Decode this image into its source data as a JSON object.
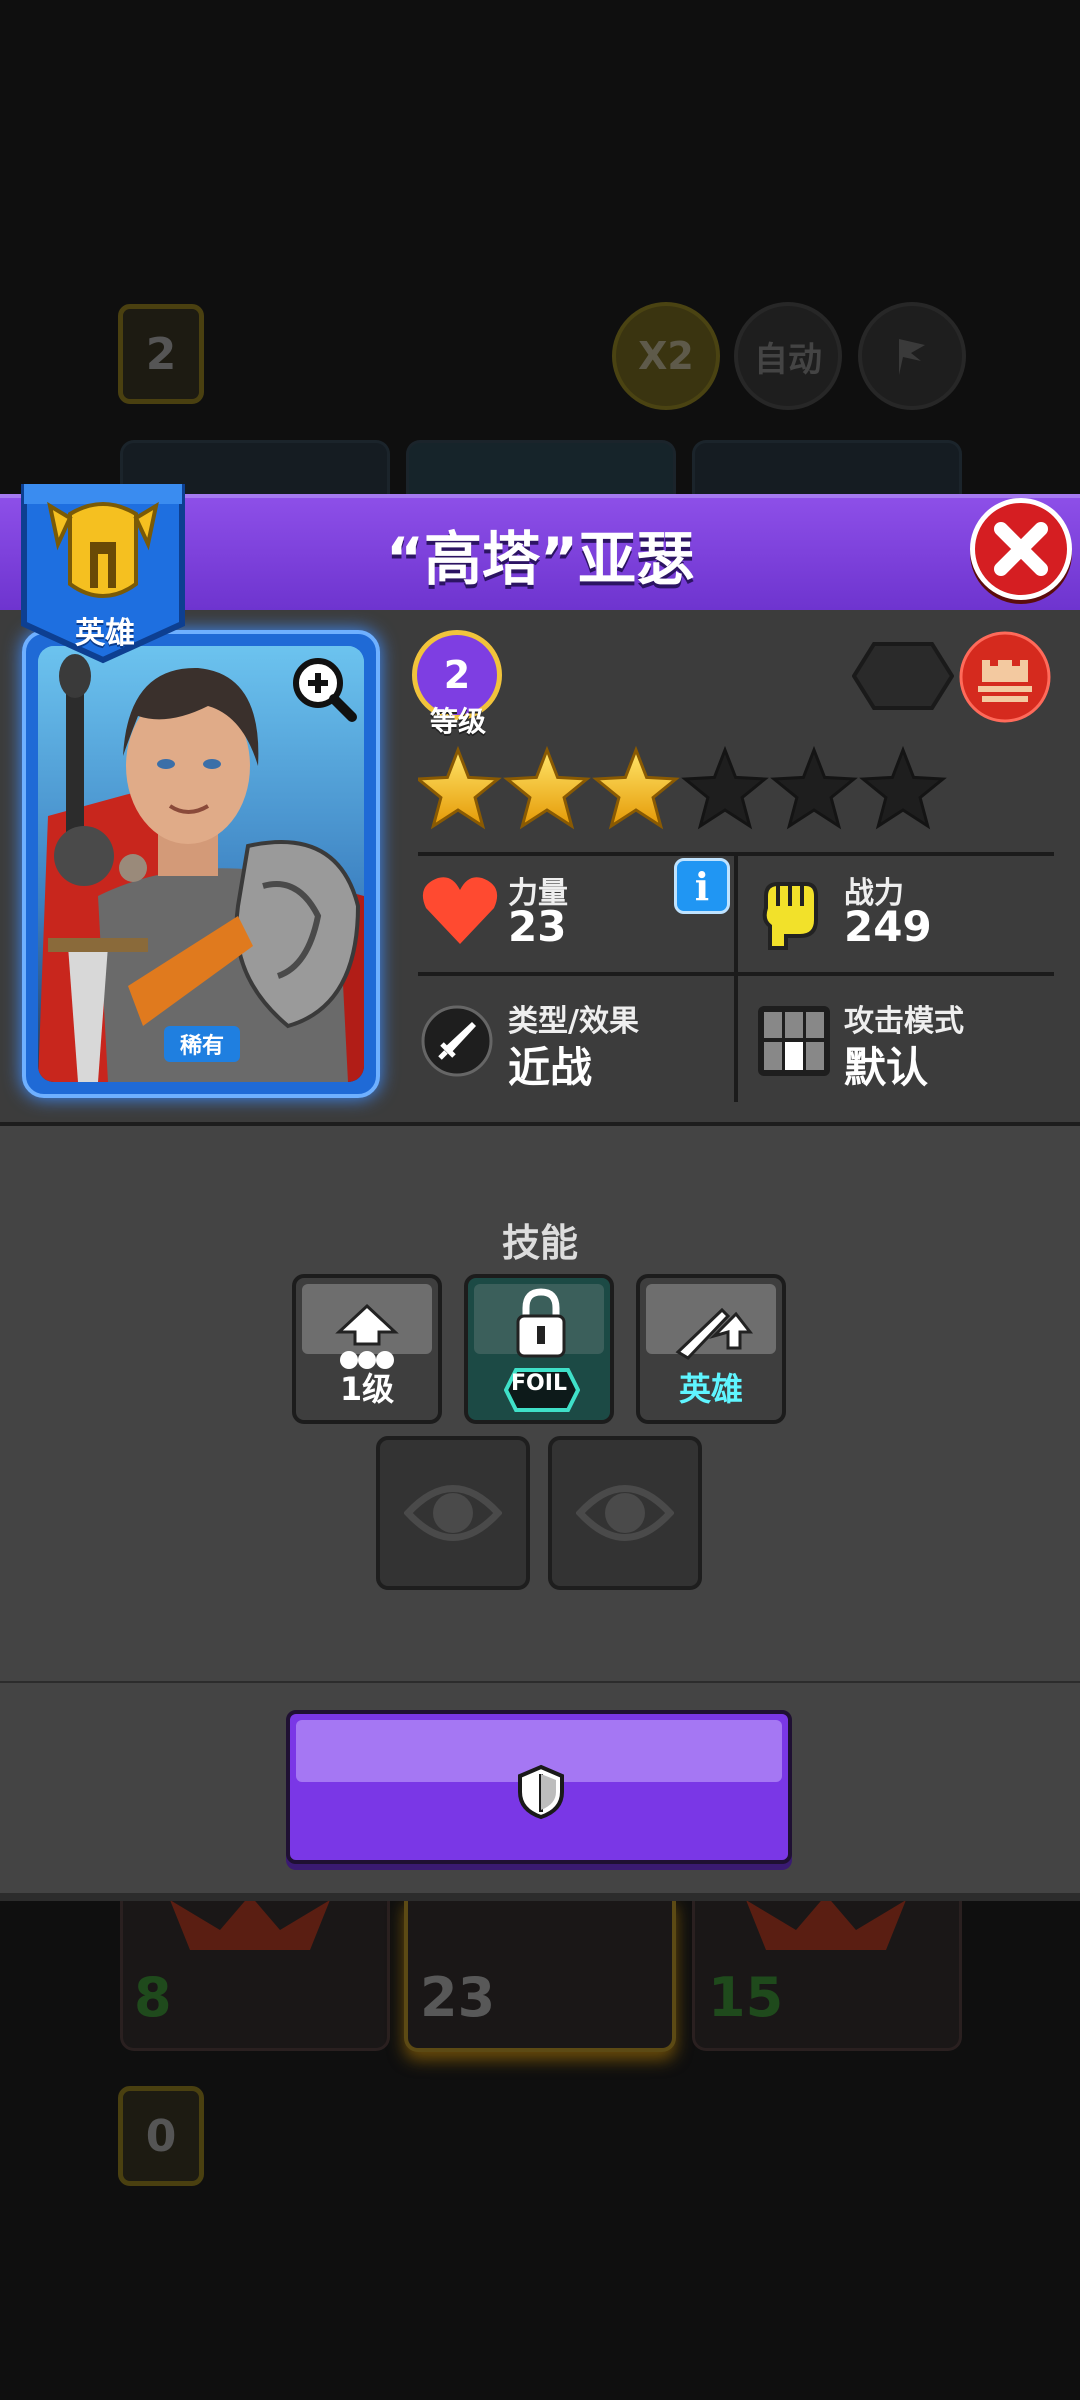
{
  "background": {
    "top_badge": "2",
    "speed_button": "X2",
    "auto_button": "自动",
    "bottom_badge": "0",
    "cards": [
      {
        "value": "8",
        "color": "#2d7a2a"
      },
      {
        "value": "23",
        "color": "#5a5a5a"
      },
      {
        "value": "15",
        "color": "#2d7a2a"
      }
    ]
  },
  "modal": {
    "title": "“高塔”亚瑟",
    "close_icon": "close-icon",
    "class_banner": "英雄",
    "rarity": "稀有",
    "level": "2",
    "level_label": "等级",
    "stars": {
      "filled": 3,
      "total": 6
    },
    "stats": {
      "power_label": "力量",
      "power_value": "23",
      "combat_label": "战力",
      "combat_value": "249",
      "type_label": "类型/效果",
      "type_value": "近战",
      "attack_label": "攻击模式",
      "attack_value": "默认"
    },
    "skills_title": "技能",
    "skills": [
      {
        "caption": "1级",
        "icon": "upgrade-icon"
      },
      {
        "caption": "FOIL",
        "icon": "lock-icon"
      },
      {
        "caption": "英雄",
        "icon": "hero-skill-icon"
      }
    ],
    "empty_slots": 2,
    "action_icon": "shield-icon",
    "colors": {
      "title_bar": "#7b3fe0",
      "close": "#d51e22",
      "card_frame": "#1f6ad6",
      "gold": "#f5c020"
    }
  }
}
